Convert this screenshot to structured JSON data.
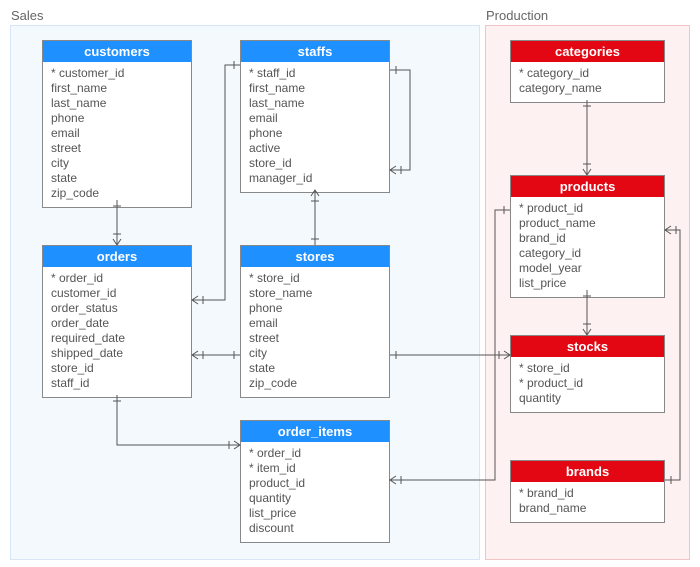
{
  "schemas": {
    "sales": {
      "label": "Sales"
    },
    "production": {
      "label": "Production"
    }
  },
  "entities": {
    "customers": {
      "title": "customers",
      "columns": [
        "* customer_id",
        "first_name",
        "last_name",
        "phone",
        "email",
        "street",
        "city",
        "state",
        "zip_code"
      ]
    },
    "staffs": {
      "title": "staffs",
      "columns": [
        "* staff_id",
        "first_name",
        "last_name",
        "email",
        "phone",
        "active",
        "store_id",
        "manager_id"
      ]
    },
    "orders": {
      "title": "orders",
      "columns": [
        "* order_id",
        "customer_id",
        "order_status",
        "order_date",
        "required_date",
        "shipped_date",
        "store_id",
        "staff_id"
      ]
    },
    "stores": {
      "title": "stores",
      "columns": [
        "* store_id",
        "store_name",
        "phone",
        "email",
        "street",
        "city",
        "state",
        "zip_code"
      ]
    },
    "order_items": {
      "title": "order_items",
      "columns": [
        "* order_id",
        "* item_id",
        "product_id",
        "quantity",
        "list_price",
        "discount"
      ]
    },
    "categories": {
      "title": "categories",
      "columns": [
        "* category_id",
        "category_name"
      ]
    },
    "products": {
      "title": "products",
      "columns": [
        "* product_id",
        "product_name",
        "brand_id",
        "category_id",
        "model_year",
        "list_price"
      ]
    },
    "stocks": {
      "title": "stocks",
      "columns": [
        "* store_id",
        "* product_id",
        "quantity"
      ]
    },
    "brands": {
      "title": "brands",
      "columns": [
        "* brand_id",
        "brand_name"
      ]
    }
  },
  "chart_data": {
    "type": "er-diagram",
    "schemas": [
      {
        "name": "Sales",
        "entities": [
          "customers",
          "staffs",
          "orders",
          "stores",
          "order_items"
        ]
      },
      {
        "name": "Production",
        "entities": [
          "categories",
          "products",
          "stocks",
          "brands"
        ]
      }
    ],
    "relationships": [
      {
        "from": "customers",
        "to": "orders",
        "cardinality": "1..*"
      },
      {
        "from": "staffs",
        "to": "orders",
        "cardinality": "1..*"
      },
      {
        "from": "staffs",
        "to": "staffs",
        "cardinality": "1..*",
        "note": "manager_id self reference"
      },
      {
        "from": "stores",
        "to": "staffs",
        "cardinality": "1..*"
      },
      {
        "from": "stores",
        "to": "orders",
        "cardinality": "1..*"
      },
      {
        "from": "stores",
        "to": "stocks",
        "cardinality": "1..*"
      },
      {
        "from": "orders",
        "to": "order_items",
        "cardinality": "1..*"
      },
      {
        "from": "products",
        "to": "order_items",
        "cardinality": "1..*"
      },
      {
        "from": "categories",
        "to": "products",
        "cardinality": "1..*"
      },
      {
        "from": "products",
        "to": "stocks",
        "cardinality": "1..*"
      },
      {
        "from": "brands",
        "to": "products",
        "cardinality": "1..*"
      }
    ]
  }
}
